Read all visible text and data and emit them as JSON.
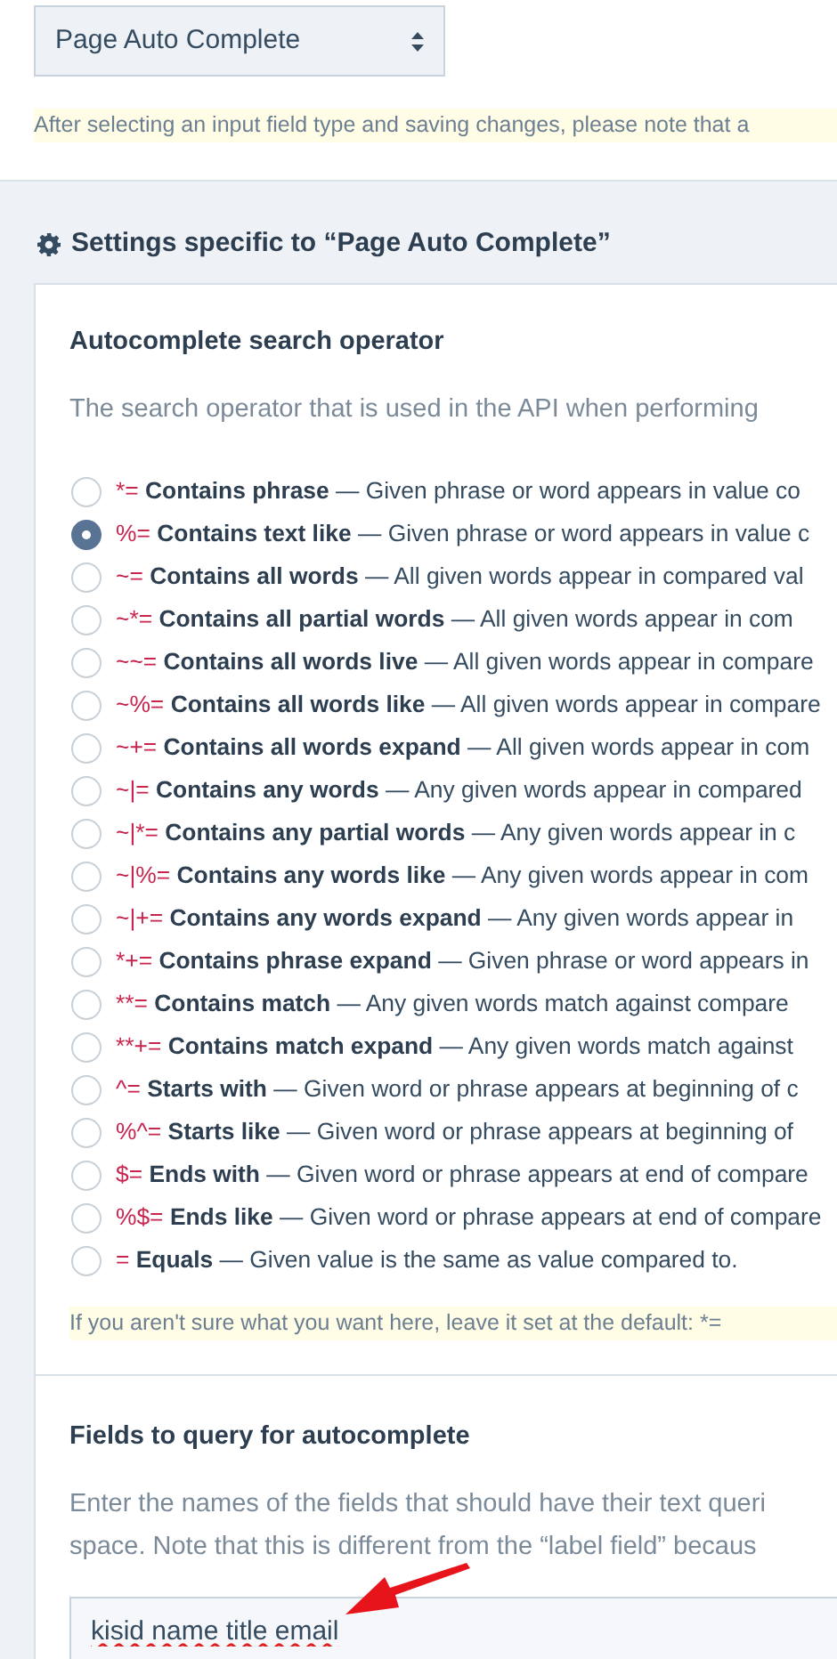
{
  "select": {
    "value": "Page Auto Complete"
  },
  "select_note": "After selecting an input field type and saving changes, please note that a",
  "settings_heading": "Settings specific to “Page Auto Complete”",
  "operator_section": {
    "heading": "Autocomplete search operator",
    "description": "The search operator that is used in the API when performing",
    "options": [
      {
        "operator": "*=",
        "label": "Contains phrase",
        "description": "— Given phrase or word appears in value co",
        "selected": false
      },
      {
        "operator": "%=",
        "label": "Contains text like",
        "description": "— Given phrase or word appears in value c",
        "selected": true
      },
      {
        "operator": "~=",
        "label": "Contains all words",
        "description": "— All given words appear in compared val",
        "selected": false
      },
      {
        "operator": "~*=",
        "label": "Contains all partial words",
        "description": "— All given words appear in com",
        "selected": false
      },
      {
        "operator": "~~=",
        "label": "Contains all words live",
        "description": "— All given words appear in compare",
        "selected": false
      },
      {
        "operator": "~%=",
        "label": "Contains all words like",
        "description": "— All given words appear in compare",
        "selected": false
      },
      {
        "operator": "~+=",
        "label": "Contains all words expand",
        "description": "— All given words appear in com",
        "selected": false
      },
      {
        "operator": "~|=",
        "label": "Contains any words",
        "description": "— Any given words appear in compared",
        "selected": false
      },
      {
        "operator": "~|*=",
        "label": "Contains any partial words",
        "description": "— Any given words appear in c",
        "selected": false
      },
      {
        "operator": "~|%=",
        "label": "Contains any words like",
        "description": "— Any given words appear in com",
        "selected": false
      },
      {
        "operator": "~|+=",
        "label": "Contains any words expand",
        "description": "— Any given words appear in",
        "selected": false
      },
      {
        "operator": "*+=",
        "label": "Contains phrase expand",
        "description": "— Given phrase or word appears in",
        "selected": false
      },
      {
        "operator": "**=",
        "label": "Contains match",
        "description": "— Any given words match against compare",
        "selected": false
      },
      {
        "operator": "**+=",
        "label": "Contains match expand",
        "description": "— Any given words match against",
        "selected": false
      },
      {
        "operator": "^=",
        "label": "Starts with",
        "description": "— Given word or phrase appears at beginning of c",
        "selected": false
      },
      {
        "operator": "%^=",
        "label": "Starts like",
        "description": "— Given word or phrase appears at beginning of",
        "selected": false
      },
      {
        "operator": "$=",
        "label": "Ends with",
        "description": "— Given word or phrase appears at end of compare",
        "selected": false
      },
      {
        "operator": "%$=",
        "label": "Ends like",
        "description": "— Given word or phrase appears at end of compare",
        "selected": false
      },
      {
        "operator": "=",
        "label": "Equals",
        "description": "— Given value is the same as value compared to.",
        "selected": false
      }
    ],
    "note": "If you aren't sure what you want here, leave it set at the default: *="
  },
  "fields_section": {
    "heading": "Fields to query for autocomplete",
    "description_lines": [
      "Enter the names of the fields that should have their text queri",
      "space. Note that this is different from the “label field” becaus"
    ],
    "value": "kisid name title email"
  }
}
